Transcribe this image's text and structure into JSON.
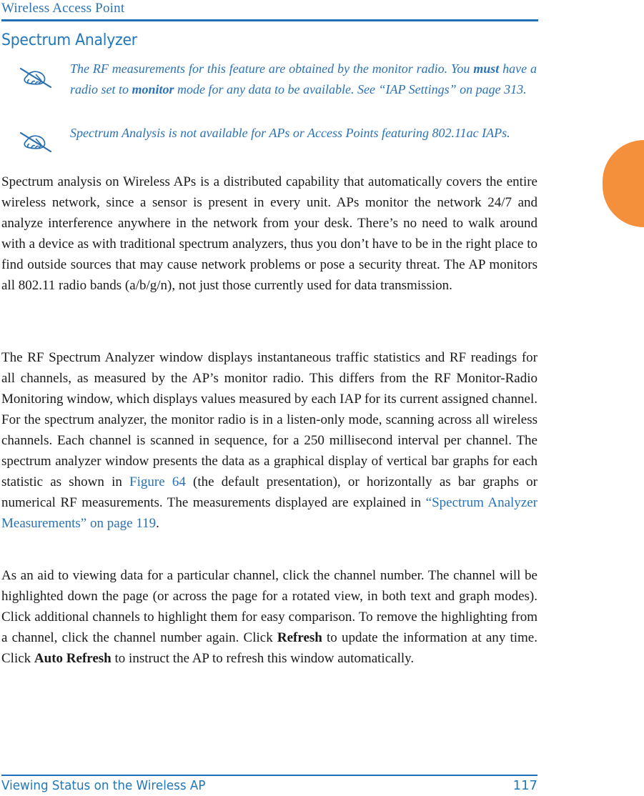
{
  "header": {
    "running_title": "Wireless Access Point",
    "rule_color": "#1f70b8"
  },
  "heading": {
    "title": "Spectrum Analyzer",
    "color": "#2278b8"
  },
  "notes": [
    {
      "icon": "note-hand-pen-icon",
      "text_prefix": "The RF measurements for this feature are obtained by the monitor radio. You ",
      "bold_1": "must",
      "text_middle": " have a radio set to ",
      "bold_2": "monitor",
      "text_suffix": " mode for any data to be available. See “IAP Settings” on page 313."
    },
    {
      "icon": "note-hand-pen-icon",
      "text": "Spectrum Analysis is not available for APs or Access Points featuring 802.11ac IAPs."
    }
  ],
  "thumb_tab": {
    "color": "#f4903c"
  },
  "paragraphs": {
    "p1": "Spectrum analysis on Wireless APs is a distributed capability that automatically covers the entire wireless network, since a sensor is present in every unit. APs monitor the network 24/7 and analyze interference anywhere in the network from your desk. There’s no need to walk around with a device as with traditional spectrum analyzers, thus you don’t have to be in the right place to find outside sources that may cause network problems or pose a security threat. The AP monitors all 802.11 radio bands (a/b/g/n), not just those currently used for data transmission.",
    "p2_part1": "The RF Spectrum Analyzer window displays instantaneous traffic statistics and RF readings for all channels, as measured by the AP’s monitor radio. This differs from the RF Monitor-Radio Monitoring window, which displays values measured by each IAP for its current assigned channel. For the spectrum analyzer, the monitor radio is in a listen-only mode, scanning across all wireless channels. Each channel is scanned in sequence, for a 250 millisecond interval per channel. The spectrum analyzer window presents the data as a graphical display of vertical bar graphs for each statistic as shown in ",
    "p2_xref1": "Figure 64",
    "p2_part2": " (the default presentation), or horizontally as bar graphs or numerical RF measurements. The measurements displayed are explained in ",
    "p2_xref2": "“Spectrum Analyzer Measurements” on page 119",
    "p2_part3": ".",
    "p3_part1": "As an aid to viewing data for a particular channel, click the channel number. The channel will be highlighted down the page (or across the page for a rotated view, in both text and graph modes). Click additional channels to highlight them for easy comparison. To remove the highlighting from a channel, click the channel number again. Click ",
    "p3_bold1": "Refresh",
    "p3_part2": " to update the information at any time. Click ",
    "p3_bold2": "Auto Refresh",
    "p3_part3": " to instruct the AP to refresh this window automatically."
  },
  "footer": {
    "left": "Viewing Status on the Wireless AP",
    "page_number": "117",
    "color": "#2278b8"
  }
}
